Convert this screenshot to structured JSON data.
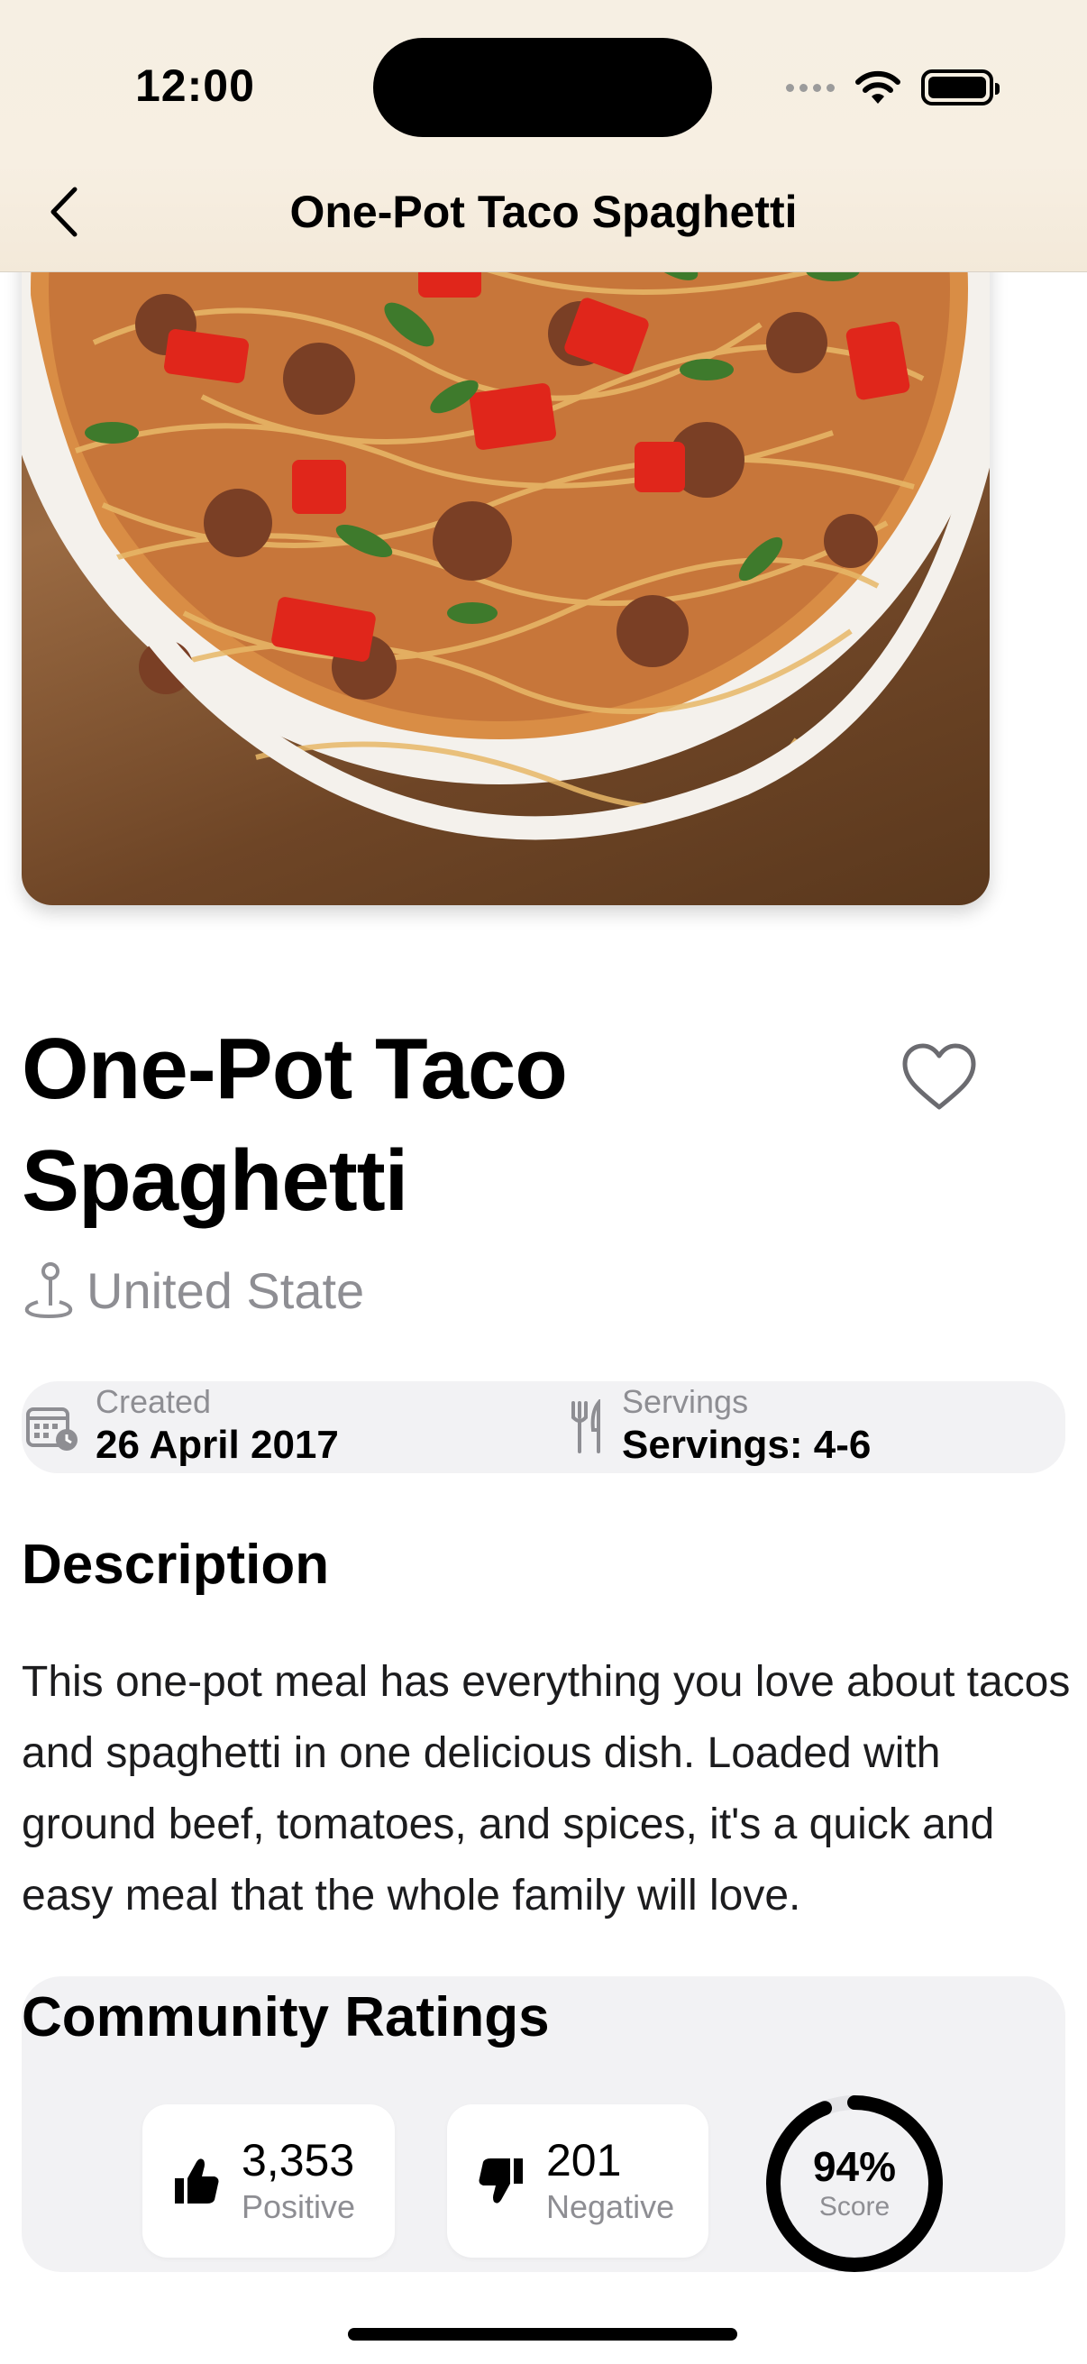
{
  "status_bar": {
    "time": "12:00"
  },
  "nav": {
    "title": "One-Pot Taco Spaghetti",
    "back_icon": "chevron-left-icon"
  },
  "recipe": {
    "title": "One-Pot Taco Spaghetti",
    "location": "United State",
    "favorite_icon": "heart-icon",
    "created_label": "Created",
    "created_value": "26 April 2017",
    "servings_label": "Servings",
    "servings_value": "Servings: 4-6",
    "description_heading": "Description",
    "description": "This one-pot meal has everything you love about tacos and spaghetti in one delicious dish. Loaded with ground beef, tomatoes, and spices, it's a quick and easy meal that the whole family will love."
  },
  "ratings": {
    "heading": "Community Ratings",
    "positive_count": "3,353",
    "positive_label": "Positive",
    "negative_count": "201",
    "negative_label": "Negative",
    "score_percent": "94%",
    "score_label": "Score",
    "score_fraction": 0.94
  },
  "colors": {
    "background": "#ffffff",
    "muted": "#8e8e93",
    "card": "#f2f2f4",
    "topbar": "#f6efe3"
  }
}
